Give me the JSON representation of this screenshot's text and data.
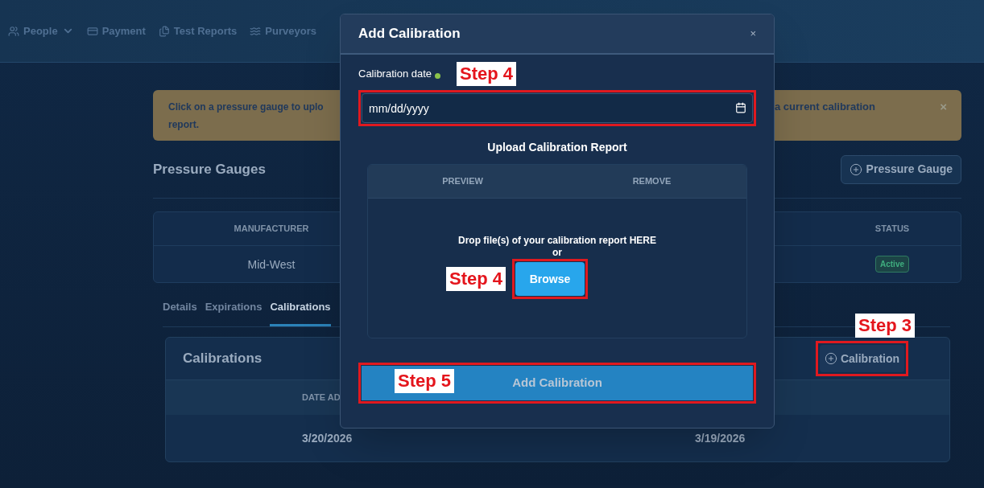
{
  "nav": [
    {
      "label": "People",
      "kind": "dropdown"
    },
    {
      "label": "Payment",
      "kind": "link"
    },
    {
      "label": "Test Reports",
      "kind": "link"
    },
    {
      "label": "Purveyors",
      "kind": "link"
    }
  ],
  "banner": {
    "lines_left": [
      "Click on a pressure gauge to uplo",
      "report."
    ],
    "text_right": "a current calibration",
    "close": "×"
  },
  "page_title": "Pressure Gauges",
  "add_gauge_button": "Pressure Gauge",
  "gauges_table": {
    "columns": [
      "MANUFACTURER",
      "STATUS"
    ],
    "rows": [
      {
        "manufacturer": "Mid-West",
        "status": "Active"
      }
    ]
  },
  "detail_tabs": [
    {
      "label": "Details",
      "selected": false
    },
    {
      "label": "Expirations",
      "selected": false
    },
    {
      "label": "Calibrations",
      "selected": true
    }
  ],
  "calibrations": {
    "title": "Calibrations",
    "add_button": "Calibration",
    "add_button_annotation": "Step 3",
    "columns": [
      "DATE AD"
    ],
    "rows": [
      [
        "3/20/2026",
        "3/19/2026"
      ]
    ]
  },
  "modal": {
    "title": "Add Calibration",
    "close": "×",
    "date_label": "Calibration date",
    "date_annotation": "Step 4",
    "date_placeholder": "mm/dd/yyyy",
    "upload_title": "Upload Calibration Report",
    "dropzone_columns": [
      "PREVIEW",
      "REMOVE"
    ],
    "drop_text": "Drop file(s) of your calibration report HERE",
    "or": "or",
    "browse_button": "Browse",
    "browse_annotation": "Step 4",
    "submit_button": "Add Calibration",
    "submit_annotation": "Step 5"
  }
}
